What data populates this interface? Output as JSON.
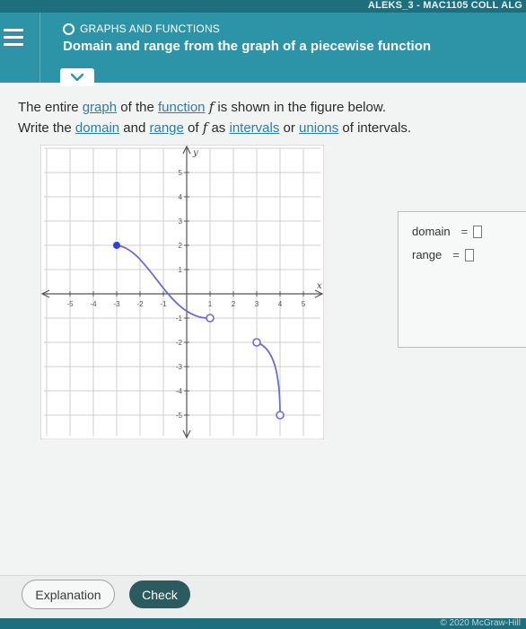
{
  "app_header": {
    "text": "ALEKS_3 - MAC1105 COLL ALG"
  },
  "topic": {
    "label": "GRAPHS AND FUNCTIONS"
  },
  "title": {
    "text": "Domain and range from the graph of a piecewise function"
  },
  "question": {
    "p1": "The entire ",
    "graph_link": "graph",
    "p2": " of the ",
    "function_link": "function",
    "f": "f",
    "p3": " is shown in the figure below.",
    "p4": "Write the ",
    "domain_link": "domain",
    "p5": " and ",
    "range_link": "range",
    "p6": " of ",
    "p7": " as ",
    "intervals_link": "intervals",
    "p8": " or ",
    "unions_link": "unions",
    "p9": " of intervals."
  },
  "graph": {
    "x_axis_label": "x",
    "y_axis_label": "y",
    "x_ticks": [
      "-5",
      "-4",
      "-3",
      "-2",
      "-1",
      "1",
      "2",
      "3",
      "4",
      "5"
    ],
    "y_ticks": [
      "5",
      "4",
      "3",
      "2",
      "1",
      "-1",
      "-2",
      "-3",
      "-4",
      "-5"
    ],
    "pieces": [
      {
        "start": [
          -3,
          2
        ],
        "start_type": "closed",
        "end": [
          1,
          -1
        ],
        "end_type": "open"
      },
      {
        "start": [
          3,
          -2
        ],
        "start_type": "open",
        "end": [
          4,
          -5
        ],
        "end_type": "open"
      }
    ],
    "colors": {
      "curve": "#6a6cd0",
      "point": "#3340d8",
      "grid": "#cfcfcf",
      "axis": "#555555"
    }
  },
  "answer": {
    "domain_label": "domain",
    "range_label": "range",
    "equals": "=",
    "domain_value": "",
    "range_value": ""
  },
  "buttons": {
    "explanation": "Explanation",
    "check": "Check"
  },
  "footer": {
    "copyright": "© 2020 McGraw-Hill"
  }
}
